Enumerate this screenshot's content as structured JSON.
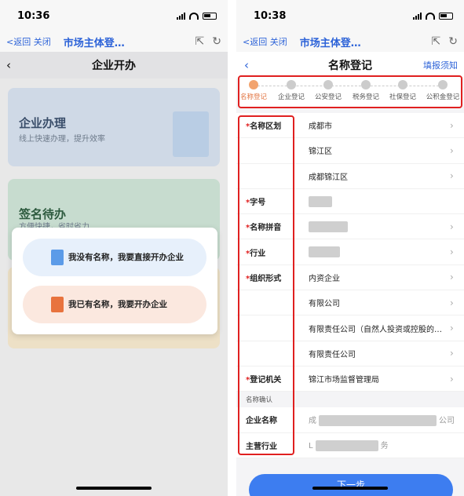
{
  "left": {
    "status": {
      "time": "10:36"
    },
    "nav": {
      "back": "<返回",
      "close": "关闭",
      "title": "市场主体登…"
    },
    "subhead": {
      "title": "企业开办"
    },
    "cards": [
      {
        "title": "企业办理",
        "subtitle": "线上快速办理，提升效率"
      },
      {
        "title": "签名待办",
        "subtitle": "方便快捷，省时省力"
      }
    ],
    "popup": {
      "option_no_name": "我没有名称，我要直接开办企业",
      "option_has_name": "我已有名称，我要开办企业"
    }
  },
  "right": {
    "status": {
      "time": "10:38"
    },
    "nav": {
      "back": "<返回",
      "close": "关闭",
      "title": "市场主体登…"
    },
    "subhead": {
      "title": "名称登记",
      "guide": "填报须知"
    },
    "steps": [
      "名称登记",
      "企业登记",
      "公安登记",
      "税务登记",
      "社保登记",
      "公积金登记"
    ],
    "active_step": 0,
    "form": {
      "region_label": "名称区划",
      "region_values": [
        "成都市",
        "锦江区",
        "成都锦江区"
      ],
      "zihao_label": "字号",
      "pinyin_label": "名称拼音",
      "industry_label": "行业",
      "org_label": "组织形式",
      "org_values": [
        "内资企业",
        "有限公司",
        "有限责任公司（自然人投资或控股的…",
        "有限责任公司"
      ],
      "authority_label": "登记机关",
      "authority_value": "锦江市场监督管理局",
      "confirm_section": "名称确认",
      "company_name_label": "企业名称",
      "company_name_prefix": "成",
      "company_name_suffix": "公司",
      "main_business_label": "主营行业",
      "main_business_prefix": "L",
      "main_business_suffix": "务"
    },
    "next_button": "下一步"
  },
  "colors": {
    "accent": "#2d63d8",
    "highlight": "#e02020",
    "active_step": "#e2733f"
  }
}
